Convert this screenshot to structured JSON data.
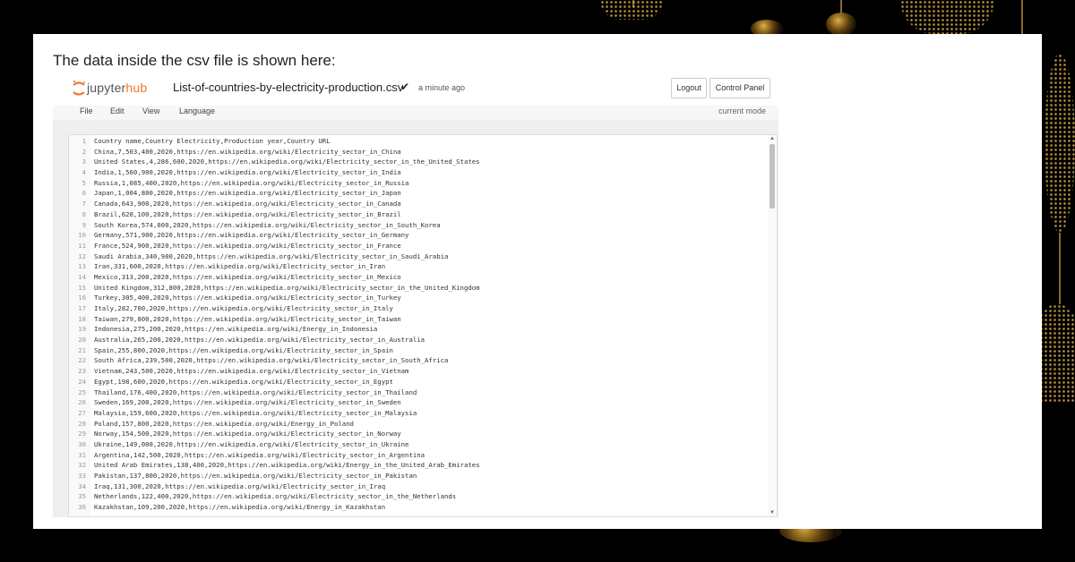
{
  "caption": "The data inside the csv file is shown here:",
  "header": {
    "logo_prefix": "jupyter",
    "logo_suffix": "hub",
    "filename": "List-of-countries-by-electricity-production.csv",
    "saved_mark": "✔",
    "modified": "a minute ago",
    "logout_label": "Logout",
    "control_panel_label": "Control Panel"
  },
  "menu": {
    "items": [
      "File",
      "Edit",
      "View",
      "Language"
    ],
    "mode": "current mode"
  },
  "editor": {
    "lines": [
      "Country name,Country Electricity,Production year,Country URL",
      "China,7,503,400,2020,https://en.wikipedia.org/wiki/Electricity_sector_in_China",
      "United States,4,286,600,2020,https://en.wikipedia.org/wiki/Electricity_sector_in_the_United_States",
      "India,1,560,900,2020,https://en.wikipedia.org/wiki/Electricity_sector_in_India",
      "Russia,1,085,400,2020,https://en.wikipedia.org/wiki/Electricity_sector_in_Russia",
      "Japan,1,004,800,2020,https://en.wikipedia.org/wiki/Electricity_sector_in_Japan",
      "Canada,643,900,2020,https://en.wikipedia.org/wiki/Electricity_sector_in_Canada",
      "Brazil,620,100,2020,https://en.wikipedia.org/wiki/Electricity_sector_in_Brazil",
      "South Korea,574,000,2020,https://en.wikipedia.org/wiki/Electricity_sector_in_South_Korea",
      "Germany,571,900,2020,https://en.wikipedia.org/wiki/Electricity_sector_in_Germany",
      "France,524,900,2020,https://en.wikipedia.org/wiki/Electricity_sector_in_France",
      "Saudi Arabia,340,900,2020,https://en.wikipedia.org/wiki/Electricity_sector_in_Saudi_Arabia",
      "Iran,331,600,2020,https://en.wikipedia.org/wiki/Electricity_sector_in_Iran",
      "Mexico,313,200,2020,https://en.wikipedia.org/wiki/Electricity_sector_in_Mexico",
      "United Kingdom,312,800,2020,https://en.wikipedia.org/wiki/Electricity_sector_in_the_United_Kingdom",
      "Turkey,305,400,2020,https://en.wikipedia.org/wiki/Electricity_sector_in_Turkey",
      "Italy,282,700,2020,https://en.wikipedia.org/wiki/Electricity_sector_in_Italy",
      "Taiwan,279,800,2020,https://en.wikipedia.org/wiki/Electricity_sector_in_Taiwan",
      "Indonesia,275,200,2020,https://en.wikipedia.org/wiki/Energy_in_Indonesia",
      "Australia,265,200,2020,https://en.wikipedia.org/wiki/Electricity_sector_in_Australia",
      "Spain,255,800,2020,https://en.wikipedia.org/wiki/Electricity_sector_in_Spain",
      "South Africa,239,500,2020,https://en.wikipedia.org/wiki/Electricity_sector_in_South_Africa",
      "Vietnam,243,500,2020,https://en.wikipedia.org/wiki/Electricity_sector_in_Vietnam",
      "Egypt,198,600,2020,https://en.wikipedia.org/wiki/Electricity_sector_in_Egypt",
      "Thailand,176,400,2020,https://en.wikipedia.org/wiki/Electricity_sector_in_Thailand",
      "Sweden,169,200,2020,https://en.wikipedia.org/wiki/Electricity_sector_in_Sweden",
      "Malaysia,159,600,2020,https://en.wikipedia.org/wiki/Electricity_sector_in_Malaysia",
      "Poland,157,800,2020,https://en.wikipedia.org/wiki/Energy_in_Poland",
      "Norway,154,500,2020,https://en.wikipedia.org/wiki/Electricity_sector_in_Norway",
      "Ukraine,149,000,2020,https://en.wikipedia.org/wiki/Electricity_sector_in_Ukraine",
      "Argentina,142,500,2020,https://en.wikipedia.org/wiki/Electricity_sector_in_Argentina",
      "United Arab Emirates,138,400,2020,https://en.wikipedia.org/wiki/Energy_in_the_United_Arab_Emirates",
      "Pakistan,137,800,2020,https://en.wikipedia.org/wiki/Electricity_sector_in_Pakistan",
      "Iraq,131,300,2020,https://en.wikipedia.org/wiki/Electricity_sector_in_Iraq",
      "Netherlands,122,400,2020,https://en.wikipedia.org/wiki/Electricity_sector_in_the_Netherlands",
      "Kazakhstan,109,200,2020,https://en.wikipedia.org/wiki/Energy_in_Kazakhstan"
    ]
  },
  "colors": {
    "background": "#000000",
    "accent_orange": "#f37726",
    "gold": "#d9a441"
  }
}
